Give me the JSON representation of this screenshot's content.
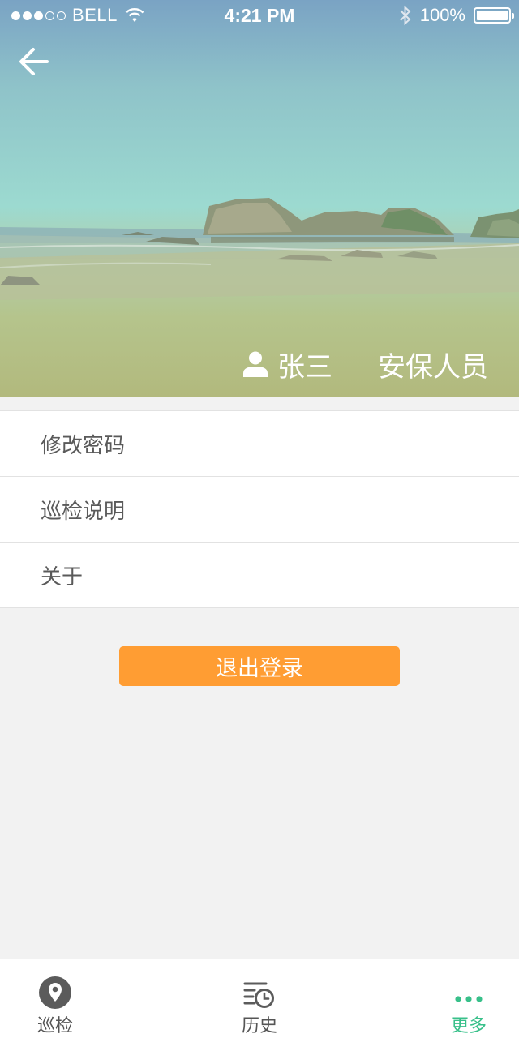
{
  "status_bar": {
    "carrier": "BELL",
    "time": "4:21 PM",
    "battery": "100%",
    "icons": [
      "wifi-icon",
      "bluetooth-icon",
      "battery-icon"
    ]
  },
  "profile": {
    "name": "张三",
    "role": "安保人员",
    "icons": [
      "back-arrow-icon",
      "user-icon"
    ]
  },
  "menu": {
    "items": [
      {
        "label": "修改密码"
      },
      {
        "label": "巡检说明"
      },
      {
        "label": "关于"
      }
    ]
  },
  "logout": {
    "label": "退出登录"
  },
  "tabbar": {
    "tabs": [
      {
        "label": "巡检",
        "icon": "location-pin-icon",
        "active": false
      },
      {
        "label": "历史",
        "icon": "history-list-icon",
        "active": false
      },
      {
        "label": "更多",
        "icon": "more-dots-icon",
        "active": true
      }
    ]
  },
  "colors": {
    "accent": "#38c08a",
    "logout_button": "#ff9d33",
    "background": "#f2f2f2"
  }
}
